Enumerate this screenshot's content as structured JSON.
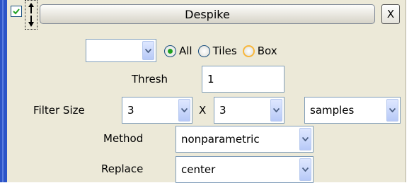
{
  "panel": {
    "title": "Despike",
    "close_label": "X",
    "enabled": true
  },
  "region": {
    "selected": "",
    "options": [
      "All",
      "Tiles",
      "Box"
    ],
    "active_option": "All"
  },
  "thresh": {
    "label": "Thresh",
    "value": "1"
  },
  "filter_size": {
    "label": "Filter Size",
    "width": "3",
    "separator": "X",
    "height": "3",
    "unit": "samples"
  },
  "method": {
    "label": "Method",
    "value": "nonparametric"
  },
  "replace": {
    "label": "Replace",
    "value": "center"
  },
  "colors": {
    "frame": "#2c54c7",
    "panel_bg": "#ece9d8",
    "check": "#21a121",
    "field_border": "#7f9db9"
  }
}
